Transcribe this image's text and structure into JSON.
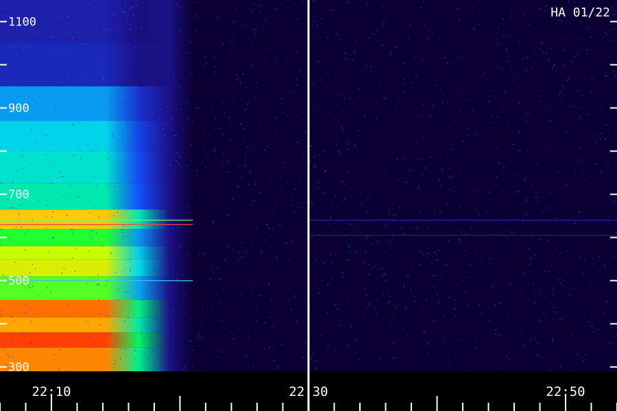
{
  "chart_data": {
    "type": "heatmap",
    "title": "",
    "annotation": "HA 01/22",
    "xlabel": "",
    "ylabel": "",
    "y_ticks": [
      {
        "value": 1100,
        "label": "1100"
      },
      {
        "value": 1000,
        "label": ""
      },
      {
        "value": 900,
        "label": "900"
      },
      {
        "value": 800,
        "label": ""
      },
      {
        "value": 700,
        "label": "700"
      },
      {
        "value": 600,
        "label": ""
      },
      {
        "value": 500,
        "label": "500"
      },
      {
        "value": 400,
        "label": ""
      },
      {
        "value": 300,
        "label": "300"
      }
    ],
    "ylim": [
      290,
      1150
    ],
    "x_ticks": [
      {
        "value": "22:10",
        "label": "22:10"
      },
      {
        "value": "22:30",
        "label": "22:30"
      },
      {
        "value": "22:50",
        "label": "22:50"
      }
    ],
    "xlim": [
      "22:06",
      "22:54"
    ],
    "divider_time": "22:30",
    "colors": {
      "background": "#0a0033",
      "low": "#1a0a7a",
      "mid": "#00ff40",
      "high": "#ff2000",
      "text": "#ffffff"
    },
    "bands": [
      {
        "freq": 330,
        "intensity": 0.88
      },
      {
        "freq": 360,
        "intensity": 0.95
      },
      {
        "freq": 400,
        "intensity": 0.85
      },
      {
        "freq": 430,
        "intensity": 0.9
      },
      {
        "freq": 480,
        "intensity": 0.65
      },
      {
        "freq": 540,
        "intensity": 0.75
      },
      {
        "freq": 560,
        "intensity": 0.72
      },
      {
        "freq": 600,
        "intensity": 0.62
      },
      {
        "freq": 640,
        "intensity": 0.82
      },
      {
        "freq": 690,
        "intensity": 0.5
      },
      {
        "freq": 760,
        "intensity": 0.47
      },
      {
        "freq": 840,
        "intensity": 0.44
      },
      {
        "freq": 900,
        "intensity": 0.38
      },
      {
        "freq": 1000,
        "intensity": 0.2
      },
      {
        "freq": 1100,
        "intensity": 0.18
      }
    ]
  }
}
